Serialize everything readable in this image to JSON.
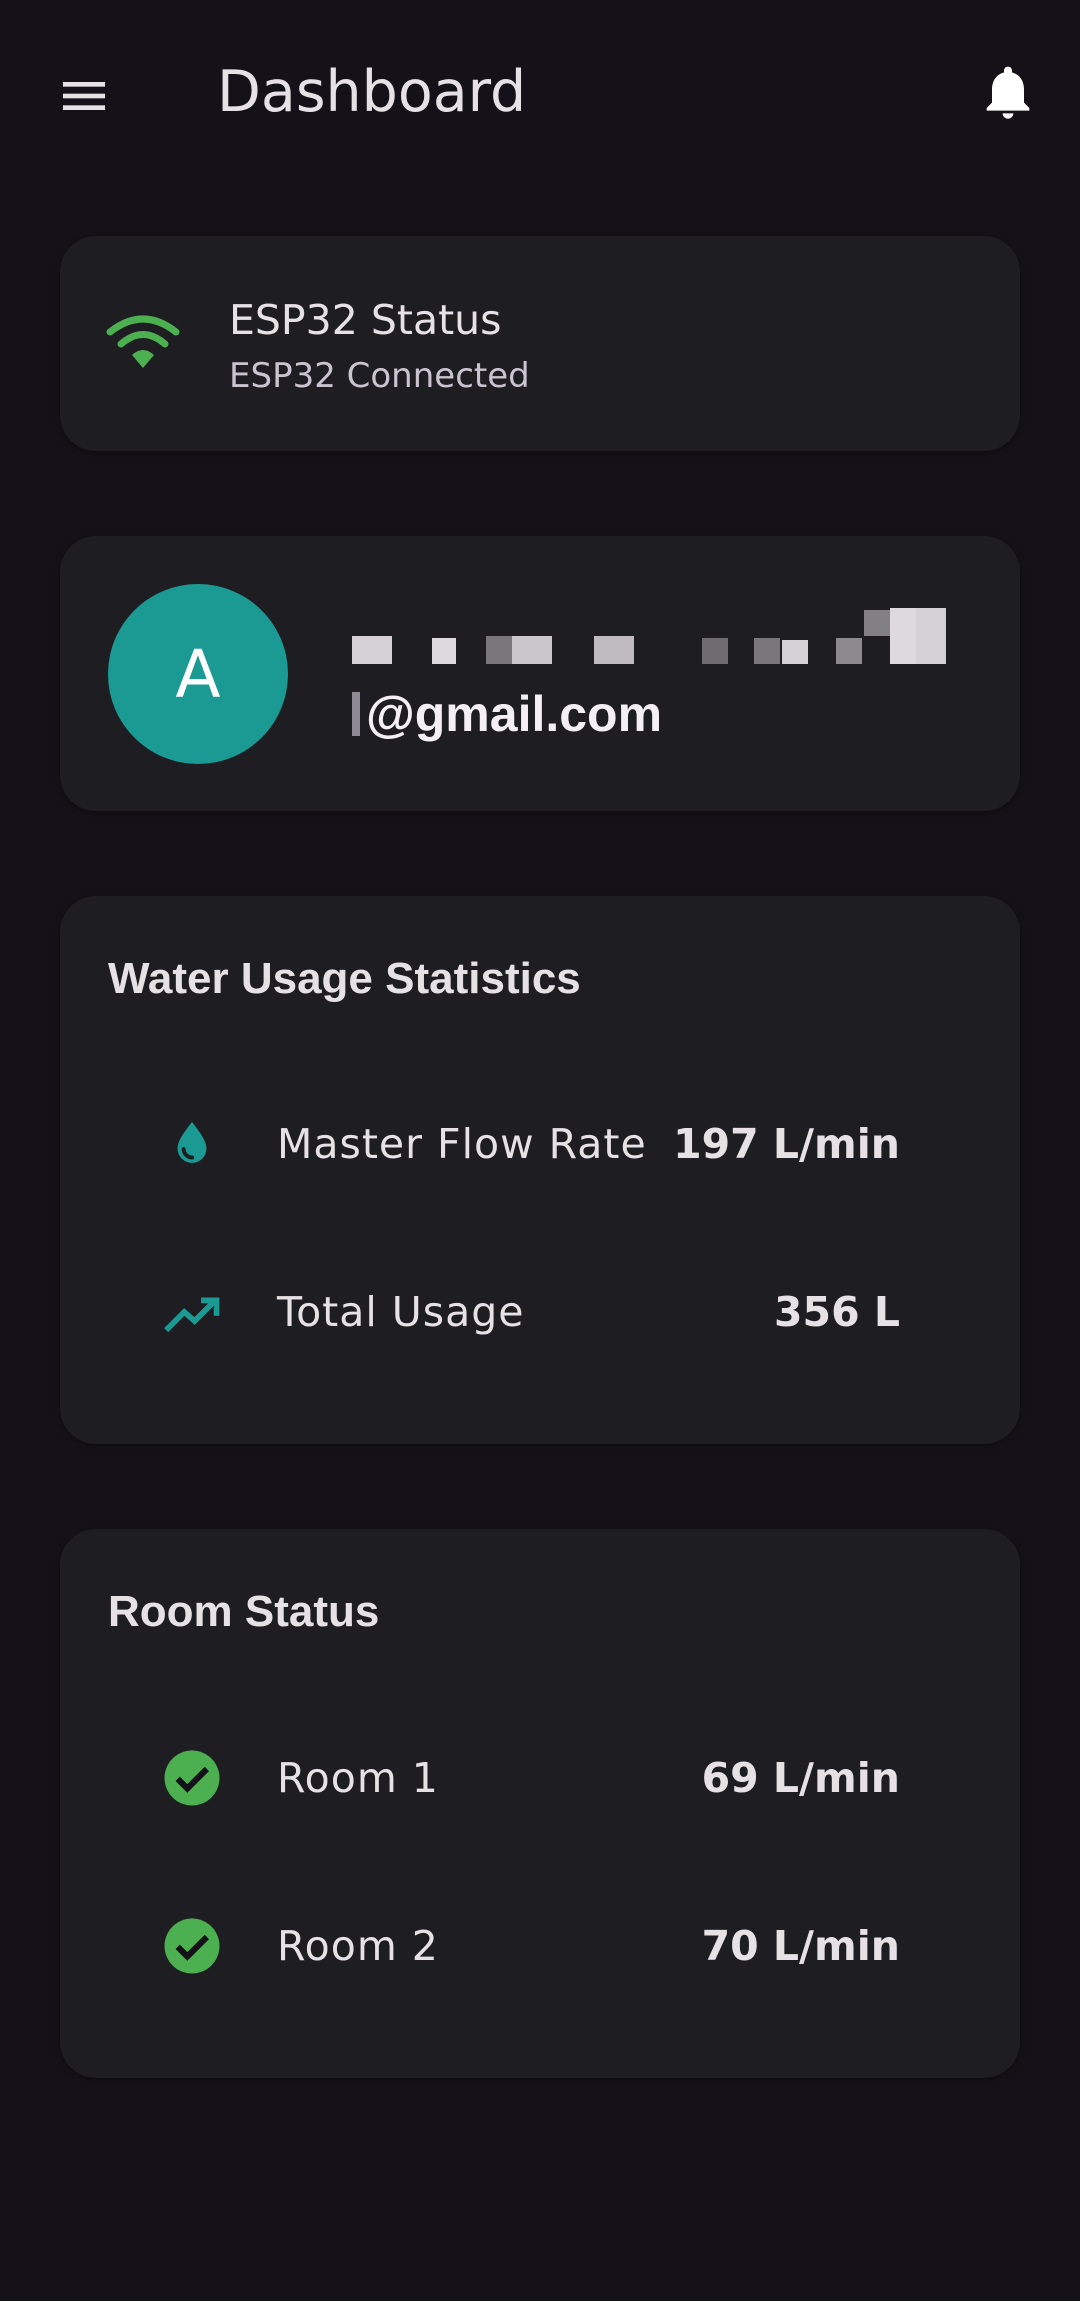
{
  "appbar": {
    "title": "Dashboard",
    "menu_icon": "hamburger-menu-icon",
    "notification_icon": "bell-icon"
  },
  "esp": {
    "title": "ESP32 Status",
    "status": "ESP32 Connected",
    "icon": "wifi-icon",
    "icon_color": "#4caf50"
  },
  "user": {
    "avatar_letter": "A",
    "avatar_color": "#1b9a94",
    "email_suffix": "@gmail.com"
  },
  "water_stats": {
    "title": "Water Usage Statistics",
    "rows": [
      {
        "icon": "water-drop-icon",
        "label": "Master Flow Rate",
        "value": "197 L/min"
      },
      {
        "icon": "trending-up-icon",
        "label": "Total Usage",
        "value": "356 L"
      }
    ]
  },
  "rooms": {
    "title": "Room Status",
    "rows": [
      {
        "icon": "check-circle-icon",
        "label": "Room 1",
        "value": "69 L/min"
      },
      {
        "icon": "check-circle-icon",
        "label": "Room 2",
        "value": "70 L/min"
      }
    ]
  },
  "colors": {
    "background": "#141218",
    "card": "#1e1d21",
    "accent_teal": "#1b9a94",
    "success_green": "#4caf50"
  }
}
